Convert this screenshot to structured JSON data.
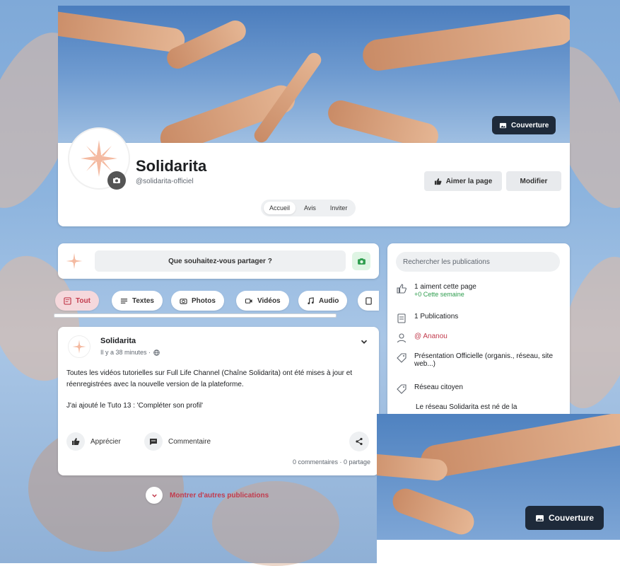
{
  "cover": {
    "button_label": "Couverture"
  },
  "profile": {
    "name": "Solidarita",
    "handle": "@solidarita-officiel",
    "tabs": [
      "Accueil",
      "Avis",
      "Inviter"
    ],
    "like_button": "Aimer la page",
    "edit_button": "Modifier"
  },
  "composer": {
    "placeholder": "Que souhaitez-vous partager ?"
  },
  "filters": [
    "Tout",
    "Textes",
    "Photos",
    "Vidéos",
    "Audio"
  ],
  "post": {
    "author": "Solidarita",
    "time": "Il y a 38 minutes ·",
    "paragraphs": [
      "Toutes les vidéos tutorielles sur Full Life Channel (Chaîne Solidarita) ont été mises à jour et réenregistrées avec la nouvelle version de la plateforme.",
      "J'ai ajouté le Tuto 13 : 'Compléter son profil'"
    ],
    "like_label": "Apprécier",
    "comment_label": "Commentaire",
    "stats": "0 commentaires · 0 partage"
  },
  "more_label": "Montrer d'autres publications",
  "sidebar": {
    "search_placeholder": "Rechercher les publications",
    "likes": "1 aiment cette page",
    "likes_week": "+0 Cette semaine",
    "publications": "1 Publications",
    "owner": "@ Ananou",
    "category": "Présentation Officielle (organis., réseau, site web...)",
    "type": "Réseau citoyen",
    "description": "Le réseau Solidarita est né de la"
  },
  "overlay": {
    "button_label": "Couverture"
  },
  "colors": {
    "accent": "#c23b4d",
    "green": "#2e9d4e",
    "dark_button": "#1e2a3a"
  }
}
